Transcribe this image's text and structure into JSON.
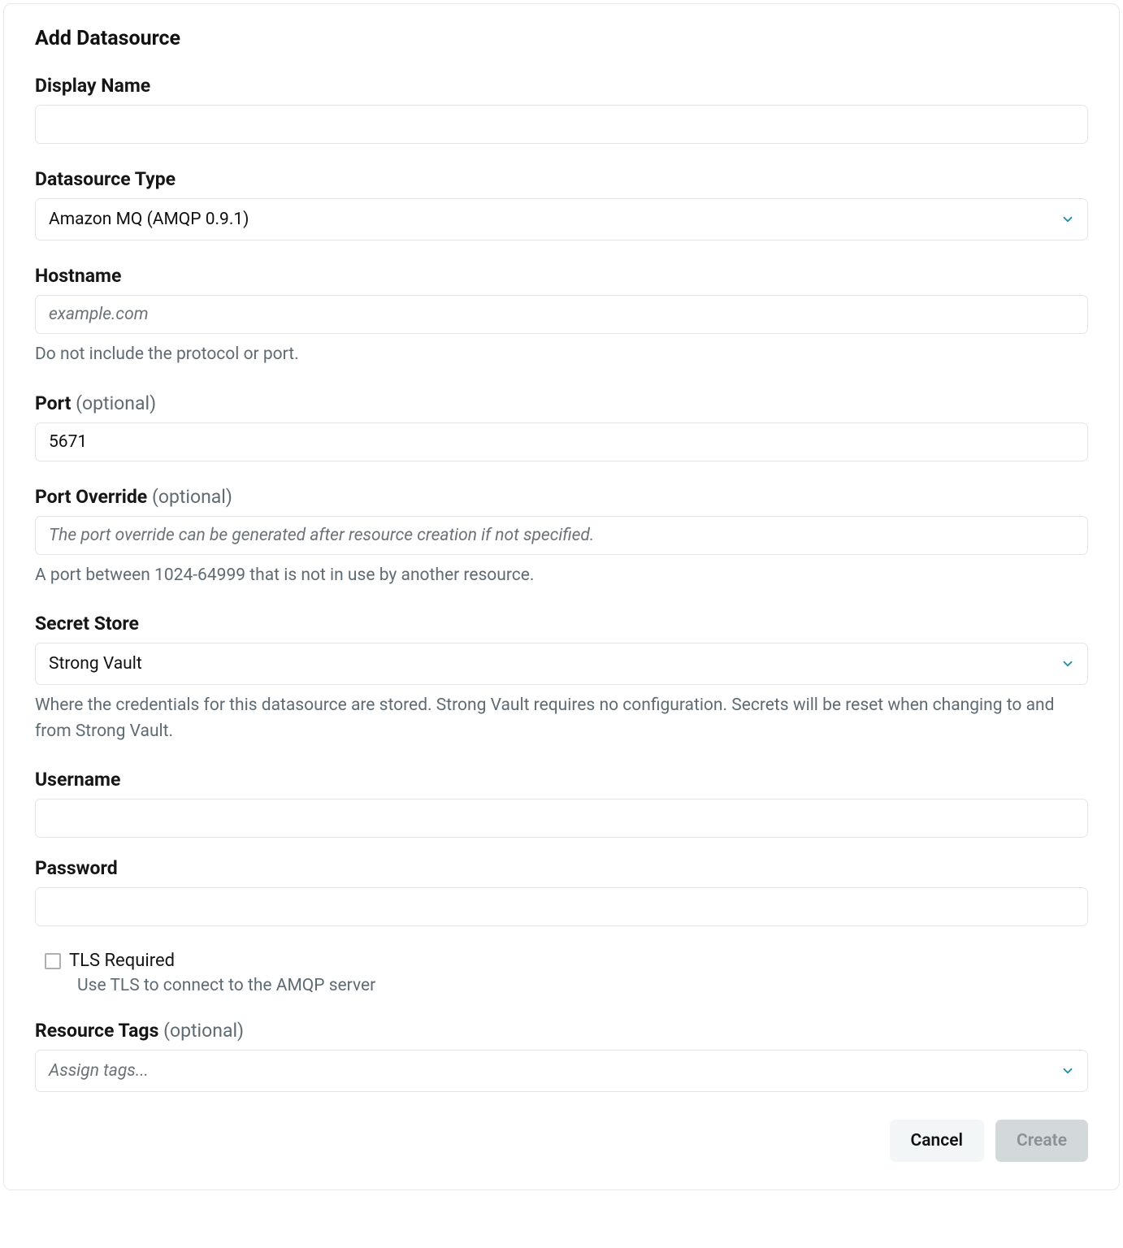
{
  "title": "Add Datasource",
  "fields": {
    "displayName": {
      "label": "Display Name",
      "value": ""
    },
    "datasourceType": {
      "label": "Datasource Type",
      "value": "Amazon MQ (AMQP 0.9.1)"
    },
    "hostname": {
      "label": "Hostname",
      "placeholder": "example.com",
      "value": "",
      "helper": "Do not include the protocol or port."
    },
    "port": {
      "label": "Port ",
      "optional": "(optional)",
      "value": "5671"
    },
    "portOverride": {
      "label": "Port Override ",
      "optional": "(optional)",
      "placeholder": "The port override can be generated after resource creation if not specified.",
      "value": "",
      "helper": "A port between 1024-64999 that is not in use by another resource."
    },
    "secretStore": {
      "label": "Secret Store",
      "value": "Strong Vault",
      "helper": "Where the credentials for this datasource are stored. Strong Vault requires no configuration. Secrets will be reset when changing to and from Strong Vault."
    },
    "username": {
      "label": "Username",
      "value": ""
    },
    "password": {
      "label": "Password",
      "value": ""
    },
    "tlsRequired": {
      "label": "TLS Required",
      "helper": "Use TLS to connect to the AMQP server",
      "checked": false
    },
    "resourceTags": {
      "label": "Resource Tags ",
      "optional": "(optional)",
      "placeholder": "Assign tags..."
    }
  },
  "buttons": {
    "cancel": "Cancel",
    "create": "Create"
  }
}
